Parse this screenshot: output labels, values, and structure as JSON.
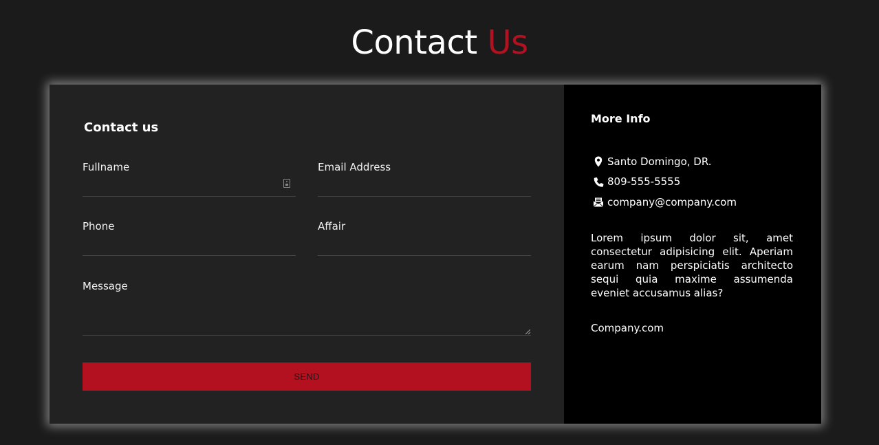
{
  "header": {
    "title_main": "Contact",
    "title_accent": "Us"
  },
  "form": {
    "heading": "Contact us",
    "fullname_label": "Fullname",
    "email_label": "Email Address",
    "phone_label": "Phone",
    "affair_label": "Affair",
    "message_label": "Message",
    "fullname_value": "",
    "email_value": "",
    "phone_value": "",
    "affair_value": "",
    "message_value": "",
    "send_label": "SEND"
  },
  "info": {
    "heading": "More Info",
    "location": "Santo Domingo, DR.",
    "phone": "809-555-5555",
    "email": "company@company.com",
    "description": "Lorem ipsum dolor sit, amet consectetur adipisicing elit. Aperiam earum nam perspiciatis architecto sequi quia maxime assumenda eveniet accusamus alias?",
    "website": "Company.com"
  },
  "colors": {
    "background": "#1b1b1b",
    "form_panel": "#222222",
    "info_panel": "#000000",
    "accent": "#b3111f"
  }
}
